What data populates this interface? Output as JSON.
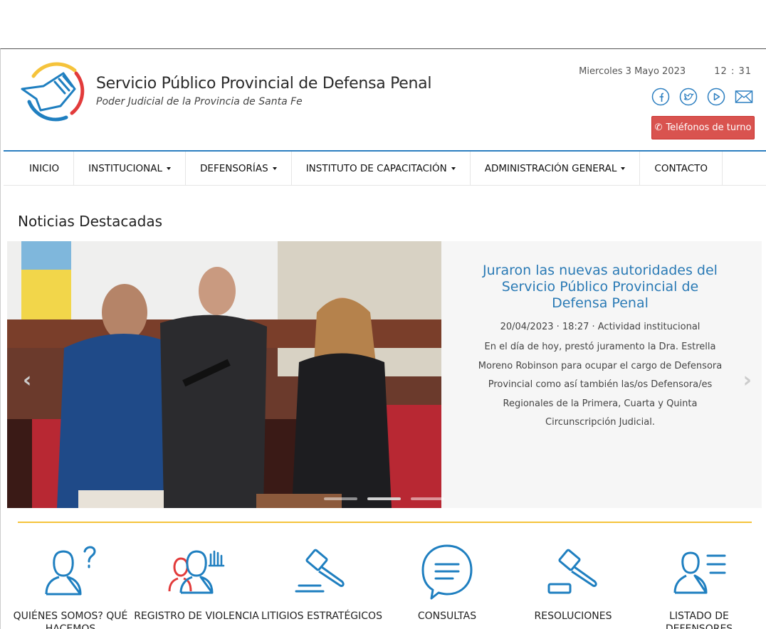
{
  "header": {
    "title": "Servicio Público Provincial de Defensa Penal",
    "subtitle": "Poder Judicial de la Provincia de Santa Fe",
    "date": "Miercoles 3 Mayo 2023",
    "time": "12 : 31",
    "social": [
      "facebook-icon",
      "twitter-icon",
      "youtube-icon",
      "mail-icon"
    ],
    "phones_button": "Teléfonos de turno"
  },
  "nav": {
    "items": [
      {
        "label": "INICIO",
        "dropdown": false
      },
      {
        "label": "INSTITUCIONAL",
        "dropdown": true
      },
      {
        "label": "DEFENSORÍAS",
        "dropdown": true
      },
      {
        "label": "INSTITUTO DE CAPACITACIÓN",
        "dropdown": true
      },
      {
        "label": "ADMINISTRACIÓN GENERAL",
        "dropdown": true
      },
      {
        "label": "CONTACTO",
        "dropdown": false
      }
    ]
  },
  "news": {
    "section_title": "Noticias Destacadas",
    "slide": {
      "title": "Juraron las nuevas autoridades del Servicio Público Provincial de Defensa Penal",
      "meta": "20/04/2023 · 18:27 · Actividad institucional",
      "body": "En el día de hoy, prestó juramento la Dra. Estrella Moreno Robinson para ocupar el cargo de Defensora Provincial como así también las/os Defensora/es Regionales de la Primera, Cuarta y Quinta Circunscripción Judicial."
    },
    "slide_count": 3,
    "active_slide": 1
  },
  "services": [
    {
      "label": "QUIÉNES SOMOS? QUÉ HACEMOS",
      "icon": "person-question-icon"
    },
    {
      "label": "REGISTRO DE VIOLENCIA",
      "icon": "people-hand-icon"
    },
    {
      "label": "LITIGIOS ESTRATÉGICOS",
      "icon": "gavel-icon"
    },
    {
      "label": "CONSULTAS",
      "icon": "chat-bubble-icon"
    },
    {
      "label": "RESOLUCIONES",
      "icon": "gavel-block-icon"
    },
    {
      "label": "LISTADO DE DEFENSORES",
      "icon": "person-list-icon"
    }
  ],
  "colors": {
    "brand_blue": "#2b7ec0",
    "accent_gold": "#f5c33b",
    "accent_red": "#d9534f",
    "icon_blue": "#1f7fc0",
    "icon_red": "#e23b3b"
  }
}
